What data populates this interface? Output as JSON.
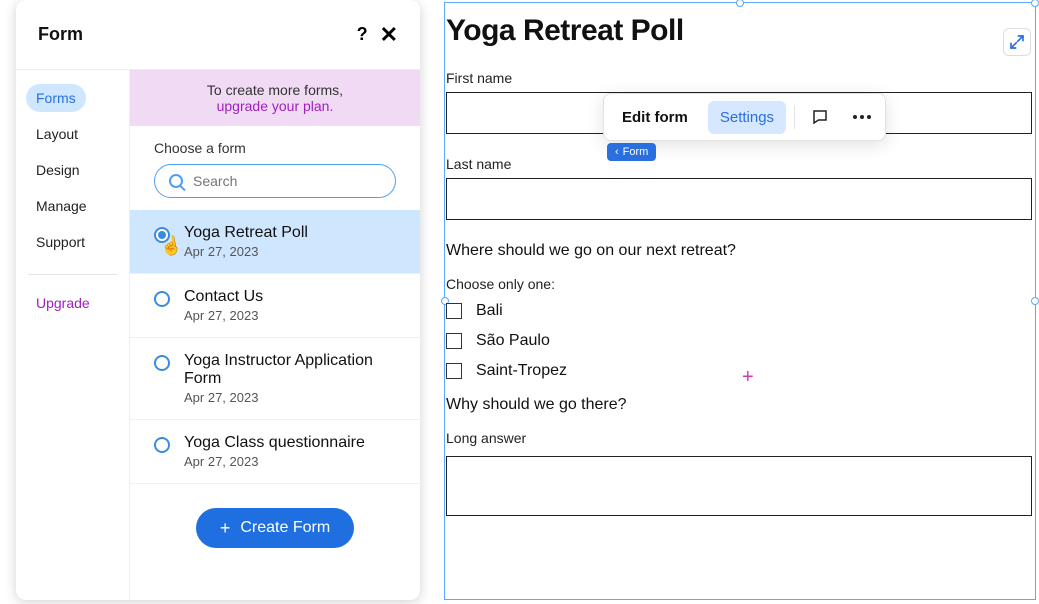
{
  "panel": {
    "title": "Form",
    "help": "?",
    "close": "✕"
  },
  "sidebar": {
    "forms": "Forms",
    "layout": "Layout",
    "design": "Design",
    "manage": "Manage",
    "support": "Support",
    "upgrade": "Upgrade"
  },
  "banner": {
    "line1": "To create more forms,",
    "line2": "upgrade your plan."
  },
  "chooseLabel": "Choose a form",
  "search": {
    "placeholder": "Search"
  },
  "forms": [
    {
      "name": "Yoga Retreat Poll",
      "date": "Apr 27, 2023",
      "selected": true
    },
    {
      "name": "Contact Us",
      "date": "Apr 27, 2023",
      "selected": false
    },
    {
      "name": "Yoga Instructor Application Form",
      "date": "Apr 27, 2023",
      "selected": false
    },
    {
      "name": "Yoga Class questionnaire",
      "date": "Apr 27, 2023",
      "selected": false
    }
  ],
  "createBtn": "Create Form",
  "toolbar": {
    "edit": "Edit form",
    "settings": "Settings"
  },
  "crumb": "Form",
  "preview": {
    "title": "Yoga Retreat Poll",
    "firstName": "First name",
    "lastName": "Last name",
    "question1": "Where should we go on our next retreat?",
    "chooseOne": "Choose only one:",
    "options": [
      "Bali",
      "São Paulo",
      "Saint-Tropez"
    ],
    "question2": "Why should we go there?",
    "longAnswer": "Long answer"
  }
}
